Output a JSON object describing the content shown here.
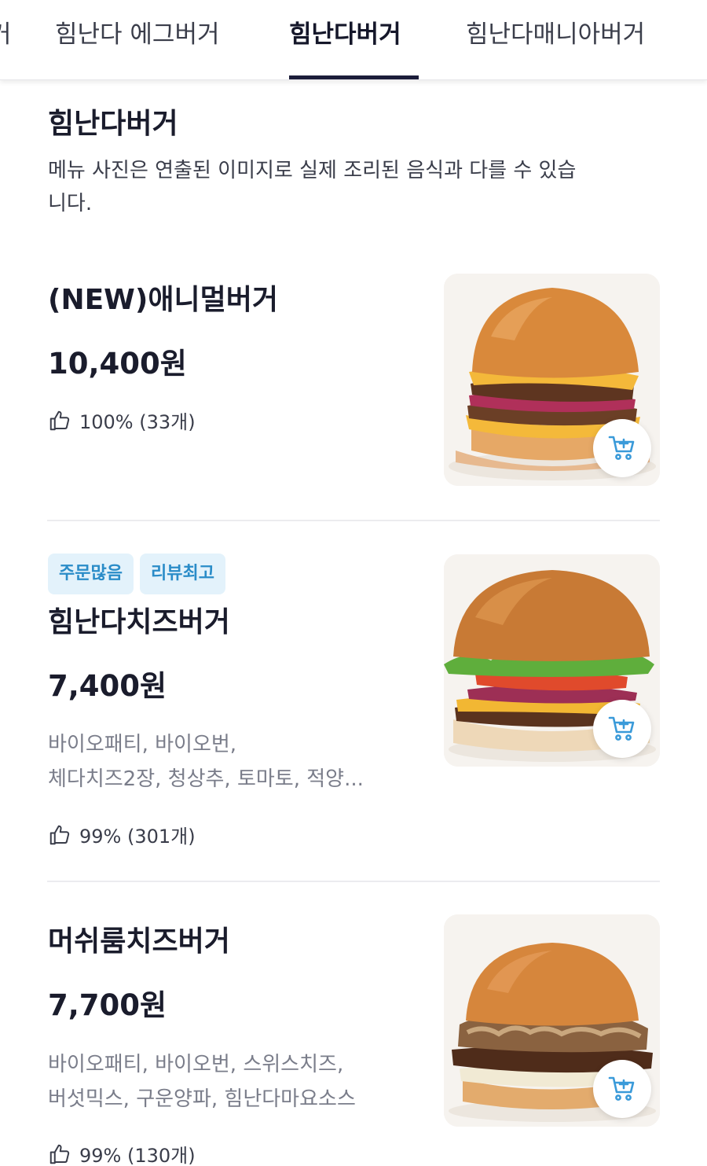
{
  "tabs": [
    {
      "label": "힘난다 에그버거",
      "active": false
    },
    {
      "label": "힘난다버거",
      "active": true
    },
    {
      "label": "힘난다매니아버거",
      "active": false
    }
  ],
  "tab_partial_left": "거",
  "section": {
    "title": "힘난다버거",
    "description": "메뉴 사진은 연출된 이미지로 실제 조리된 음식과 다를 수 있습니다."
  },
  "items": [
    {
      "name": "(NEW)애니멀버거",
      "price": "10,400원",
      "badges": [],
      "desc_lines": [],
      "rating": "100% (33개)"
    },
    {
      "name": "힘난다치즈버거",
      "price": "7,400원",
      "badges": [
        "주문많음",
        "리뷰최고"
      ],
      "desc_lines": [
        "바이오패티, 바이오번,",
        "체다치즈2장, 청상추, 토마토, 적양..."
      ],
      "rating": "99% (301개)"
    },
    {
      "name": "머쉬룸치즈버거",
      "price": "7,700원",
      "badges": [],
      "desc_lines": [
        "바이오패티, 바이오번, 스위스치즈,",
        "버섯믹스, 구운양파, 힘난다마요소스"
      ],
      "rating": "99% (130개)"
    }
  ],
  "icons": {
    "like": "thumbs-up-icon",
    "cart": "add-to-cart-icon"
  },
  "colors": {
    "accent": "#1c1d3a",
    "badge_bg": "#e3f2fb",
    "badge_text": "#2a8cc8",
    "cart_icon": "#3a9ad9"
  }
}
